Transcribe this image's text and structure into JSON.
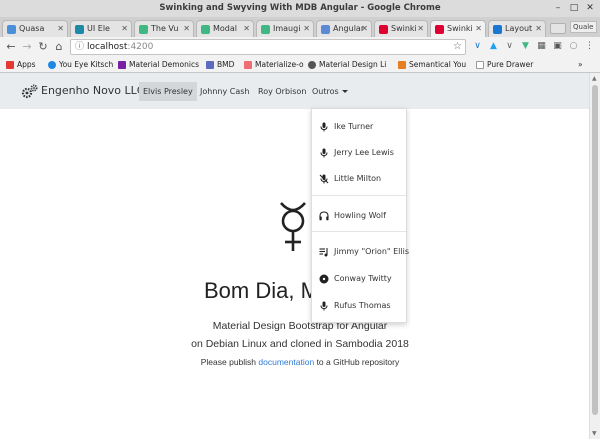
{
  "window": {
    "title": "Swinking and Swyving With MDB Angular - Google Chrome"
  },
  "tabs": [
    {
      "label": "Quasa",
      "color": "#4a90d9"
    },
    {
      "label": "UI Ele",
      "color": "#1e88a8"
    },
    {
      "label": "The Vu",
      "color": "#41b883"
    },
    {
      "label": "Modal",
      "color": "#41b883"
    },
    {
      "label": "Imaugi",
      "color": "#41b883"
    },
    {
      "label": "Angular",
      "color": "#5c8ad6"
    },
    {
      "label": "Swinki",
      "color": "#dd0031"
    },
    {
      "label": "Swinki",
      "color": "#dd0031",
      "active": true
    },
    {
      "label": "Layout",
      "color": "#1976d2"
    }
  ],
  "profile": "Quale",
  "address": {
    "host": "localhost",
    "port": ":4200"
  },
  "bookmarks": [
    {
      "label": "Apps",
      "color": "#e53935"
    },
    {
      "label": "You Eye Kitsch",
      "color": "#1e88e5"
    },
    {
      "label": "Material Demonics",
      "color": "#7b1fa2"
    },
    {
      "label": "BMD",
      "color": "#5c6bc0"
    },
    {
      "label": "Materialize-o",
      "color": "#ee6e73"
    },
    {
      "label": "Material Design Li",
      "color": "#555555"
    },
    {
      "label": "Semantical You",
      "color": "#e67e22"
    },
    {
      "label": "Pure Drawer",
      "color": "#999999"
    }
  ],
  "navbar": {
    "brand": "Engenho Novo LLC",
    "links": [
      "Elvis Presley",
      "Johnny Cash",
      "Roy Orbison",
      "Outros"
    ]
  },
  "dropdown": {
    "items": [
      {
        "label": "Ike Turner",
        "icon": "microphone-icon"
      },
      {
        "label": "Jerry Lee Lewis",
        "icon": "microphone-icon"
      },
      {
        "label": "Little Milton",
        "icon": "microphone-off-icon"
      },
      {
        "label": "Howling Wolf",
        "icon": "headphones-icon"
      },
      {
        "label": "Jimmy \"Orion\" Ellis",
        "icon": "playlist-music-icon"
      },
      {
        "label": "Conway Twitty",
        "icon": "record-icon"
      },
      {
        "label": "Rufus Thomas",
        "icon": "microphone-icon"
      }
    ]
  },
  "main": {
    "greeting": "Bom Dia, Mo",
    "subtitle_line1": "Material Design Bootstrap for Angular",
    "subtitle_line2": "on Debian Linux and cloned in Sambodia 2018",
    "publish_prefix": "Please publish",
    "publish_link": "documentation",
    "publish_suffix": "to a GitHub repository"
  }
}
